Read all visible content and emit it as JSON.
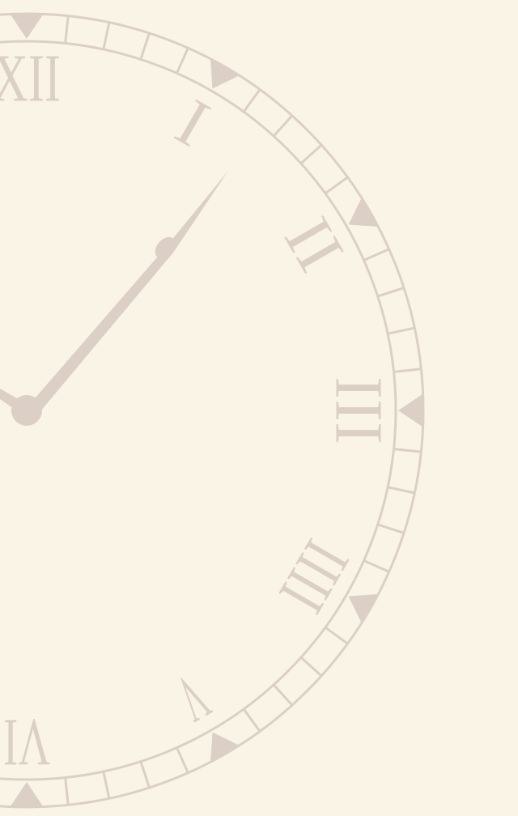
{
  "wallpaper": {
    "background_color": "#faf4e7",
    "ink_color": "#dccfc6",
    "numerals": [
      "XII",
      "I",
      "II",
      "III",
      "IIII",
      "V",
      "VI"
    ],
    "visible_numerals": [
      "I",
      "II",
      "III",
      "IIII",
      "V"
    ],
    "partially_visible_numerals": [
      "XII",
      "VI"
    ],
    "hand_icon": "clock-hand-icon",
    "center_icon": "clock-hub-icon"
  }
}
